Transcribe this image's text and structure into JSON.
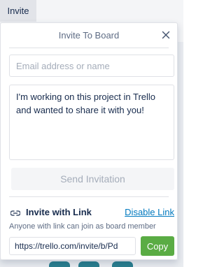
{
  "header": {
    "invite_button_label": "Invite"
  },
  "popover": {
    "title": "Invite To Board",
    "email_placeholder": "Email address or name",
    "message_text": "I'm working on this project in Trello and wanted to share it with you!",
    "send_label": "Send Invitation",
    "invite_link": {
      "title": "Invite with Link",
      "disable_label": "Disable Link",
      "note": "Anyone with link can join as board member",
      "url_value": "https://trello.com/invite/b/Pd",
      "copy_label": "Copy"
    }
  },
  "icons": {
    "close": "close-icon",
    "link": "link-icon"
  },
  "colors": {
    "copy_button": "#5aac44",
    "link_text": "#0079bf",
    "send_disabled_text": "#a5adba"
  }
}
